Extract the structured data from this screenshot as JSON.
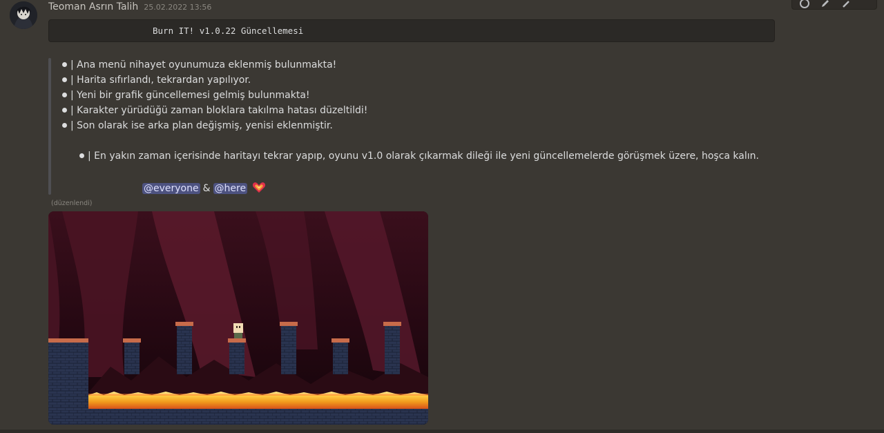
{
  "message": {
    "author": "Teoman Asrın Talih",
    "timestamp": "25.02.2022 13:56",
    "code_title": "Burn IT! v1.0.22 Güncellemesi",
    "quote_lines": [
      "| Ana menü nihayet oyunumuza eklenmiş bulunmakta!",
      "| Harita sıfırlandı, tekrardan yapılıyor.",
      "| Yeni bir grafik güncellemesi gelmiş bulunmakta!",
      "| Karakter yürüdüğü zaman bloklara takılma hatası düzeltildi!",
      "| Son olarak ise arka plan değişmiş, yenisi eklenmiştir."
    ],
    "closing_line": "| En yakın zaman içerisinde haritayı tekrar yapıp, oyunu v1.0 olarak çıkarmak dileği ile yeni güncellemelerde görüşmek üzere, hoşca kalın.",
    "mentions": {
      "everyone": "@everyone",
      "ampersand": "&",
      "here": "@here"
    },
    "edited_label": "(düzenlendi)",
    "reaction_emoji_icon": "flaming-heart-icon"
  },
  "toolbar": {
    "icons": [
      "reaction-icon",
      "edit-icon",
      "more-icon"
    ]
  },
  "colors": {
    "background": "#3b3833",
    "mention_bg": "#4d5280",
    "mention_text": "#dee0fc",
    "code_bg": "#2b2926",
    "lava": "#f0a020"
  }
}
